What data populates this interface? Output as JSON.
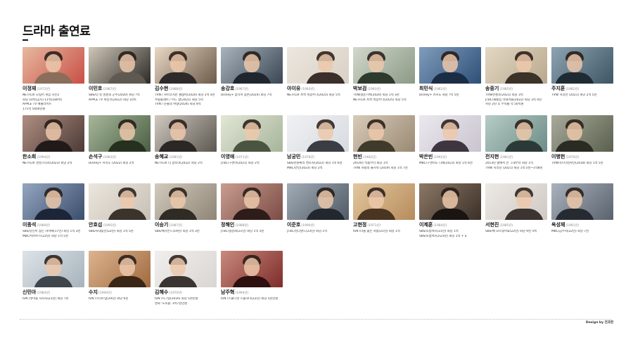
{
  "page": {
    "title": "드라마 출연료",
    "credit": "Design by 전과현"
  },
  "actors": [
    {
      "name": "이정재",
      "year": "(1972년)",
      "info": [
        "NETFLIX 오징어 게임 시즌2",
        "회당 10억(공지) 11억(180억)",
        "APPLE TV 애콜라이트",
        "171억 5400만원"
      ],
      "hl": [
        0,
        3
      ],
      "tone": [
        "#c94f45",
        "#e6b9a0",
        "#8a6d5a"
      ]
    },
    {
      "name": "이민호",
      "year": "(1987년)",
      "info": [
        "SBS/더 킹 영원의 군주(2020) 회당 ?억",
        "APPLE TV 파친코(2022) 회당 10억"
      ],
      "hl": [
        1
      ],
      "tone": [
        "#2c2a26",
        "#cfc7b8",
        "#5f5a51"
      ]
    },
    {
      "name": "김수현",
      "year": "(1988년)",
      "info": [
        "TVN / 사이코지만 괜찮아(2020) 회당 2억 4천",
        "쿠팡플레이 / 어느 날(2021) 회당 5억",
        "TVN / 눈물의 여왕(2024) 회당 8억"
      ],
      "hl": [
        2
      ],
      "tone": [
        "#6d5b4b",
        "#e9d8c4",
        "#2d2a29"
      ]
    },
    {
      "name": "송강호",
      "year": "(1967년)",
      "info": [
        "Disney+ 삼식이 삼촌(2024) 회당 7억"
      ],
      "hl": [
        0
      ],
      "tone": [
        "#3a4653",
        "#a9b4bd",
        "#1f2630"
      ]
    },
    {
      "name": "아이유",
      "year": "(1993년)",
      "info": [
        "NETFLIX 폭싹 속았수다(2025) 회당 5억"
      ],
      "hl": [
        0
      ],
      "tone": [
        "#d9d1c6",
        "#ece6de",
        "#3a2f2b"
      ]
    },
    {
      "name": "박보검",
      "year": "(1993년)",
      "info": [
        "TVN/청춘기록(2020) 회당 1억 3천",
        "NETFLIX 폭싹 속았수다(2025) 회당 5억"
      ],
      "hl": [
        1
      ],
      "tone": [
        "#8b9a86",
        "#d2d8cc",
        "#2f3a2e"
      ]
    },
    {
      "name": "최민식",
      "year": "(1962년)",
      "info": [
        "Disney+ 카지노 회당 ?억 5천"
      ],
      "hl": [
        0
      ],
      "tone": [
        "#2f4f78",
        "#7f9dbb",
        "#1b2d44"
      ]
    },
    {
      "name": "송중기",
      "year": "(1985년)",
      "info": [
        "TVN/빈센조(2021) 회당 3억",
        "JTBC/재벌집 막내아들(2022) 회당 3억 4천",
        "저당 2년 후 수익률 약 50억원"
      ],
      "hl": [
        1
      ],
      "tone": [
        "#b9a88d",
        "#e3d8c4",
        "#3b3228"
      ]
    },
    {
      "name": "주지훈",
      "year": "(1982년)",
      "info": [
        "TVN/ 지리산 (2021) 회당 2억 5천"
      ],
      "hl": [
        0
      ],
      "tone": [
        "#3e5565",
        "#8ea4b2",
        "#1f2b33"
      ]
    },
    {
      "name": "한소희",
      "year": "(1994년)",
      "info": [
        "NETFLIX 경성크리처(2023) 회당 2억"
      ],
      "hl": [
        0
      ],
      "tone": [
        "#4c3a36",
        "#b08f82",
        "#221a19"
      ]
    },
    {
      "name": "손석구",
      "year": "(1983년)",
      "info": [
        "Disney+ 카지노 (2022) 회당 2억"
      ],
      "hl": [
        0
      ],
      "tone": [
        "#4b5f44",
        "#a7b79a",
        "#26301f"
      ]
    },
    {
      "name": "송혜교",
      "year": "(1981년)",
      "info": [
        "NETFLIX 더 글로리(2022) 회당 2억"
      ],
      "hl": [
        0
      ],
      "tone": [
        "#5c5750",
        "#cfc9c0",
        "#2b2724"
      ]
    },
    {
      "name": "이영애",
      "year": "(1971년)",
      "info": [
        "JTBC/구경이(2021) 회당 2억"
      ],
      "hl": [
        0
      ],
      "tone": [
        "#a7b59a",
        "#e2e6d6",
        "#4b5440"
      ]
    },
    {
      "name": "남궁민",
      "year": "(1978년)",
      "info": [
        "SBS/천원짜리 변호사(2022) 회당 1억 6천",
        "MBC/연인(2023) 회당 2억"
      ],
      "hl": [
        1
      ],
      "tone": [
        "#d7dbe0",
        "#f0f1f3",
        "#3a3d43"
      ]
    },
    {
      "name": "현빈",
      "year": "(1982년)",
      "info": [
        "2014년 작품부터 회당 1억",
        "TVN/ 사랑의 불시착 (2019) 회당 1억 7천"
      ],
      "hl": [
        1
      ],
      "tone": [
        "#9a8a74",
        "#d8cbb8",
        "#3f3a2a"
      ]
    },
    {
      "name": "박은빈",
      "year": "(1992년)",
      "info": [
        "MBC/구경이도 디에(2023) 회당 1억 6천"
      ],
      "hl": [
        0
      ],
      "tone": [
        "#c9c4cf",
        "#ebe8ef",
        "#3d3540"
      ]
    },
    {
      "name": "전지현",
      "year": "(1981년)",
      "info": [
        "2013년 별에서 온 그대부터 회당 1억",
        "TVN/ 지리산 (2021) 회당 1억 5천~1억8천"
      ],
      "hl": [
        1
      ],
      "tone": [
        "#6c8c86",
        "#b8ccc6",
        "#2b3a37"
      ]
    },
    {
      "name": "이병헌",
      "year": "(1970년)",
      "info": [
        "TVN/미스터션샤인(2018) 회당 1억 5천"
      ],
      "hl": [
        0
      ],
      "tone": [
        "#5a5f4e",
        "#a8ab99",
        "#2a2b22"
      ]
    },
    {
      "name": "이종석",
      "year": "(1989년)",
      "info": [
        "SBS/당신이 잠든 사이에(17년) 회당 1억 3천",
        "MBC/빅마우스(22년) 회당 1억 5천"
      ],
      "hl": [
        1
      ],
      "tone": [
        "#3b4d6c",
        "#94a6bf",
        "#1d2638"
      ]
    },
    {
      "name": "안효섭",
      "year": "(1995년)",
      "info": [
        "SBS/사내맞선(22년) 회당 1억 5천"
      ],
      "hl": [
        0
      ],
      "tone": [
        "#c7c0b5",
        "#ebe6de",
        "#3a342c"
      ]
    },
    {
      "name": "이승기",
      "year": "(1987년)",
      "info": [
        "SBS/배가본드(19년) 회당 1억 3천"
      ],
      "hl": [
        0
      ],
      "tone": [
        "#8e8576",
        "#d2cabc",
        "#2f2b25"
      ]
    },
    {
      "name": "정해인",
      "year": "(1988년)",
      "info": [
        "JTBC/설강화(21년) 회당 1억 3천"
      ],
      "hl": [
        0
      ],
      "tone": [
        "#7b4c44",
        "#c89d90",
        "#2d1c19"
      ]
    },
    {
      "name": "이준호",
      "year": "(1990년)",
      "info": [
        "JTBC/킹더랜드(23년) 회당 1억"
      ],
      "hl": [
        0
      ],
      "tone": [
        "#4f5a66",
        "#a2acb6",
        "#22282e"
      ]
    },
    {
      "name": "고현정",
      "year": "(1971년)",
      "info": [
        "tvN /너를 닮은 사람(21년) 회당 1억"
      ],
      "hl": [
        0
      ],
      "tone": [
        "#b68c5b",
        "#e3c79f",
        "#4a3422"
      ]
    },
    {
      "name": "이제훈",
      "year": "(1984년)",
      "info": [
        "SBS/모범택시(21년) 회당 1억",
        "SBS/모범택시2(23년) 회당 1억 + a"
      ],
      "hl": [
        1
      ],
      "tone": [
        "#3b3028",
        "#8c7866",
        "#1a1512"
      ]
    },
    {
      "name": "서현진",
      "year": "(1985년)",
      "info": [
        "SBS/배 모르겠어요(22년) 회당 9천 5백"
      ],
      "hl": [
        0
      ],
      "tone": [
        "#cfc9c4",
        "#ede9e5",
        "#3b3430"
      ]
    },
    {
      "name": "옥성재",
      "year": "(1991년)",
      "info": [
        "MBC/금수저(22년) 회당 7천"
      ],
      "hl": [
        0
      ],
      "tone": [
        "#59626d",
        "#aab3bd",
        "#262b31"
      ]
    },
    {
      "name": "신민아",
      "year": "(1984년)",
      "info": [
        "tvN /갯마을 차차차(21년) 회당 7천"
      ],
      "hl": [
        0
      ],
      "tone": [
        "#a7b3bc",
        "#dde3e8",
        "#3e464c"
      ]
    },
    {
      "name": "수지",
      "year": "(1994년)",
      "info": [
        "tvN /스타트업(20년) 회당 6천"
      ],
      "hl": [
        0
      ],
      "tone": [
        "#a06a3f",
        "#dcb48f",
        "#3a2616"
      ]
    },
    {
      "name": "김혜수",
      "year": "(1970년)",
      "info": [
        "tvN /시그널(2016) 회당 5천만원",
        "영화 '도둑들' 3억7천만원"
      ],
      "hl": [
        0
      ],
      "tone": [
        "#d9d6d2",
        "#f1efed",
        "#3a3532"
      ]
    },
    {
      "name": "남주혁",
      "year": "(1994년)",
      "info": [
        "tvN /스물다섯 스물하나(22년) 회당 5천만원"
      ],
      "hl": [
        0
      ],
      "tone": [
        "#7e2c2a",
        "#c98a7d",
        "#2d100f"
      ]
    }
  ]
}
